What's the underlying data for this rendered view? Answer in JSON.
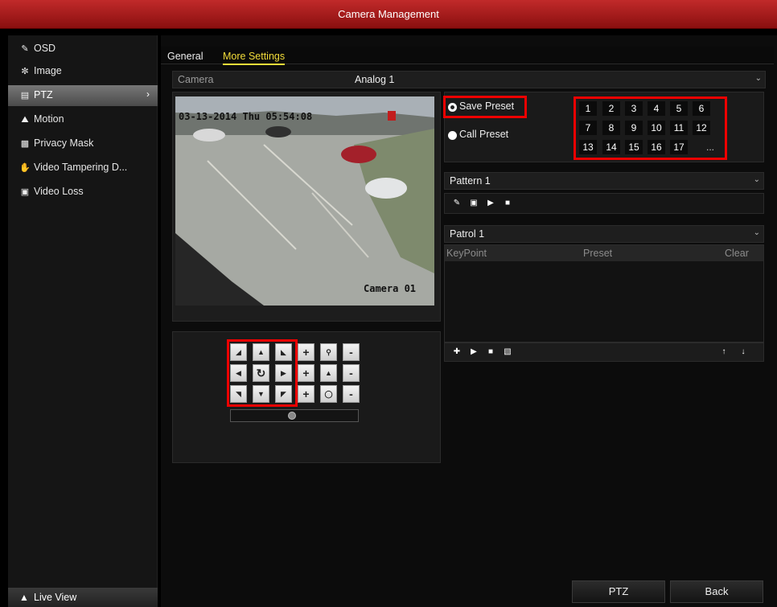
{
  "window": {
    "title": "Camera Management"
  },
  "sidebar": {
    "items": [
      {
        "label": "OSD",
        "icon": "osd-icon"
      },
      {
        "label": "Image",
        "icon": "image-icon"
      },
      {
        "label": "PTZ",
        "icon": "ptz-icon",
        "active": true
      },
      {
        "label": "Motion",
        "icon": "motion-icon"
      },
      {
        "label": "Privacy Mask",
        "icon": "privacy-mask-icon"
      },
      {
        "label": "Video Tampering D...",
        "icon": "video-tampering-icon"
      },
      {
        "label": "Video Loss",
        "icon": "video-loss-icon"
      }
    ],
    "live_view": "Live View"
  },
  "tabs": [
    {
      "label": "General"
    },
    {
      "label": "More Settings",
      "selected": true
    }
  ],
  "camera": {
    "label": "Camera",
    "value": "Analog 1"
  },
  "preview": {
    "timestamp": "03-13-2014 Thu 05:54:08",
    "camera_name": "Camera 01"
  },
  "presets": {
    "save_label": "Save Preset",
    "call_label": "Call Preset",
    "selected": "Save Preset",
    "numbers": [
      "1",
      "2",
      "3",
      "4",
      "5",
      "6",
      "7",
      "8",
      "9",
      "10",
      "11",
      "12",
      "13",
      "14",
      "15",
      "16",
      "17",
      "..."
    ]
  },
  "pattern": {
    "value": "Pattern 1"
  },
  "patrol": {
    "value": "Patrol 1",
    "columns": [
      "KeyPoint",
      "Preset",
      "Clear"
    ]
  },
  "ptz_controls": {
    "zoom": [
      "+",
      "-"
    ],
    "focus": [
      "+",
      "-"
    ],
    "iris": [
      "+",
      "-"
    ]
  },
  "buttons": {
    "ptz": "PTZ",
    "back": "Back"
  },
  "colors": {
    "title_bar": "#b01c1c",
    "active_tab": "#f3dd3a",
    "highlight": "#e00000"
  }
}
